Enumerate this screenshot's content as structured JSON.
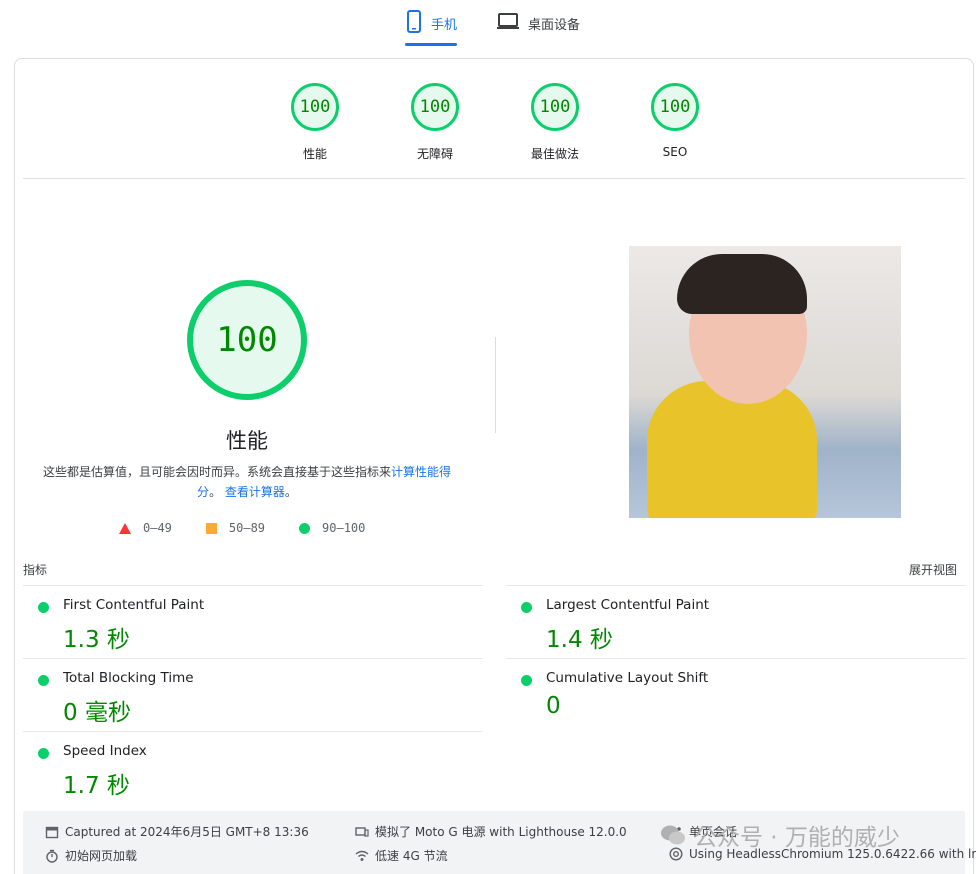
{
  "tabs": {
    "mobile_label": "手机",
    "desktop_label": "桌面设备"
  },
  "categories": [
    {
      "score": "100",
      "label": "性能"
    },
    {
      "score": "100",
      "label": "无障碍"
    },
    {
      "score": "100",
      "label": "最佳做法"
    },
    {
      "score": "100",
      "label": "SEO"
    }
  ],
  "performance": {
    "score": "100",
    "title": "性能",
    "desc_text": "这些都是估算值，且可能会因时而异。系统会直接基于这些指标来",
    "desc_link1": "计算性能得分",
    "desc_sep": "。",
    "desc_link2": "查看计算器",
    "desc_end": "。"
  },
  "legend": {
    "fail": "0–49",
    "average": "50–89",
    "pass": "90–100"
  },
  "metrics_header": {
    "title": "指标",
    "expand": "展开视图"
  },
  "metrics": [
    {
      "name": "First Contentful Paint",
      "value": "1.3 秒"
    },
    {
      "name": "Largest Contentful Paint",
      "value": "1.4 秒"
    },
    {
      "name": "Total Blocking Time",
      "value": "0 毫秒"
    },
    {
      "name": "Cumulative Layout Shift",
      "value": "0"
    },
    {
      "name": "Speed Index",
      "value": "1.7 秒"
    }
  ],
  "footer": {
    "captured": "Captured at 2024年6月5日 GMT+8 13:36",
    "device": "模拟了 Moto G 电源 with Lighthouse 12.0.0",
    "session": "单页会话",
    "load": "初始网页加载",
    "throttle": "低速 4G 节流",
    "browser": "Using HeadlessChromium 125.0.6422.66 with lr"
  },
  "watermark": "公众号 · 万能的威少",
  "colors": {
    "accent": "#1a73e8",
    "pass": "#0cce6b",
    "pass_text": "#008800",
    "average": "#ffaa33",
    "fail": "#ff3333"
  }
}
